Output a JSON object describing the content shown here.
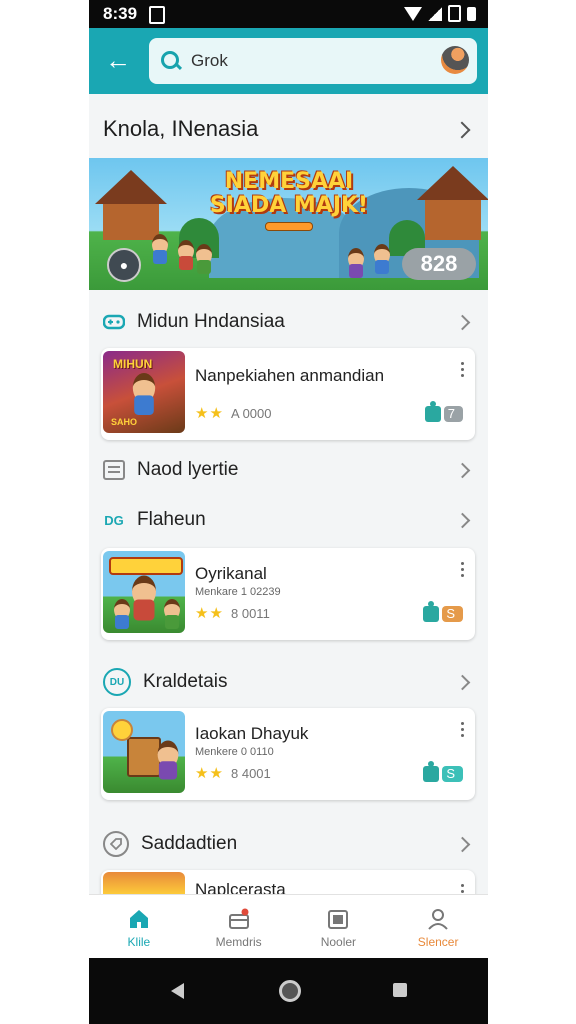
{
  "status_bar": {
    "time": "8:39"
  },
  "search": {
    "query": "Grok"
  },
  "hero": {
    "title": "Knola, INenasia"
  },
  "banner": {
    "title_line1": "NEMESAAI",
    "title_line2": "SIADA MAJK!",
    "score": "828"
  },
  "sections": [
    {
      "title": "Midun Hndansiaa",
      "icon": "gamepad-icon"
    },
    {
      "title": "Naod lyertie",
      "icon": "list-icon"
    },
    {
      "title": "Flaheun",
      "icon": "dg-icon",
      "icon_text": "DG"
    },
    {
      "title": "Kraldetais",
      "icon": "badge-icon",
      "icon_text": "DU"
    },
    {
      "title": "Saddadtien",
      "icon": "tag-icon"
    }
  ],
  "cards": [
    {
      "title": "Nanpekiahen anmandian",
      "subtitle": "",
      "rating": "A 0000",
      "badge": "7",
      "thumb_text": "MIHUN",
      "thumb_tag": "SAHO",
      "pill_color": "#9aa2a6"
    },
    {
      "title": "Oyrikanal",
      "subtitle": "Menkare 1 02239",
      "rating": "8 0011",
      "badge": "S",
      "thumb_text": "",
      "thumb_tag": "",
      "pill_color": "#e59a4a"
    },
    {
      "title": "Iaokan Dhayuk",
      "subtitle": "Menkere 0 0110",
      "rating": "8 4001",
      "badge": "S",
      "thumb_text": "",
      "thumb_tag": "",
      "pill_color": "#3cc0b8"
    },
    {
      "title": "Naplcerasta",
      "subtitle": "",
      "rating": "",
      "badge": "",
      "thumb_text": "",
      "thumb_tag": "",
      "pill_color": "#9aa2a6"
    }
  ],
  "bottom_nav": [
    {
      "label": "Klile",
      "icon": "home-icon",
      "color": "#1aa7b3"
    },
    {
      "label": "Memdris",
      "icon": "gift-icon",
      "color": "#777777"
    },
    {
      "label": "Nooler",
      "icon": "store-icon",
      "color": "#777777"
    },
    {
      "label": "Slencer",
      "icon": "profile-icon",
      "color": "#e8893a"
    }
  ],
  "colors": {
    "accent": "#1aa7b3",
    "star": "#f5c01a",
    "text": "#222222"
  }
}
